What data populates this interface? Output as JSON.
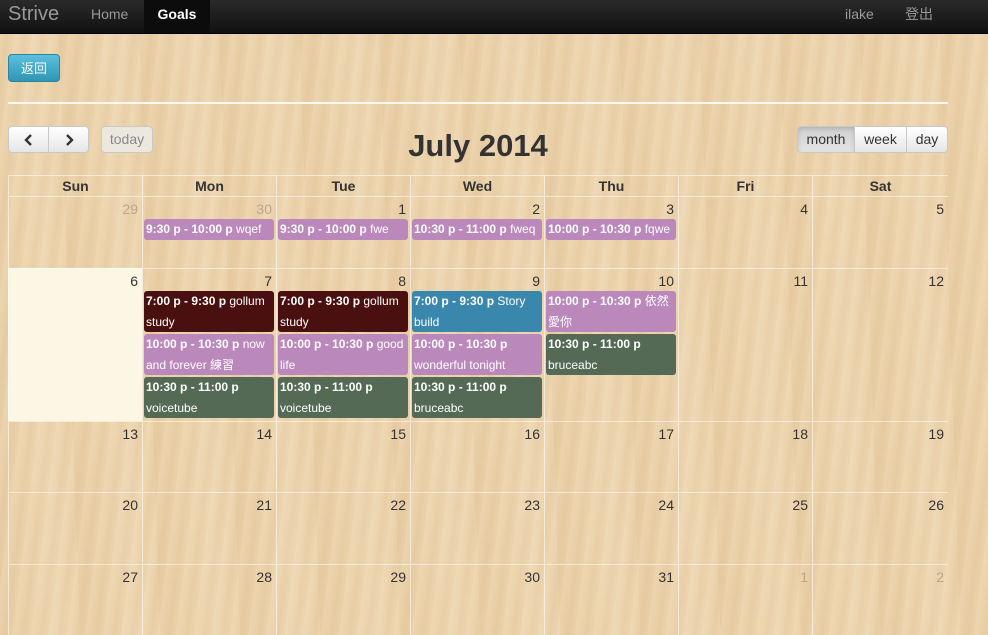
{
  "navbar": {
    "brand": "Strive",
    "home": "Home",
    "goals": "Goals",
    "user": "ilake",
    "logout": "登出"
  },
  "back_button": "返回",
  "toolbar": {
    "today": "today",
    "title": "July 2014",
    "views": [
      "month",
      "week",
      "day"
    ],
    "active_view": "month"
  },
  "calendar": {
    "weekdays": [
      "Sun",
      "Mon",
      "Tue",
      "Wed",
      "Thu",
      "Fri",
      "Sat"
    ],
    "today": "6",
    "weeks": [
      [
        {
          "d": "29",
          "other": true
        },
        {
          "d": "30",
          "other": true
        },
        {
          "d": "1"
        },
        {
          "d": "2"
        },
        {
          "d": "3"
        },
        {
          "d": "4"
        },
        {
          "d": "5"
        }
      ],
      [
        {
          "d": "6",
          "today": true
        },
        {
          "d": "7"
        },
        {
          "d": "8"
        },
        {
          "d": "9"
        },
        {
          "d": "10"
        },
        {
          "d": "11"
        },
        {
          "d": "12"
        }
      ],
      [
        {
          "d": "13"
        },
        {
          "d": "14"
        },
        {
          "d": "15"
        },
        {
          "d": "16"
        },
        {
          "d": "17"
        },
        {
          "d": "18"
        },
        {
          "d": "19"
        }
      ],
      [
        {
          "d": "20"
        },
        {
          "d": "21"
        },
        {
          "d": "22"
        },
        {
          "d": "23"
        },
        {
          "d": "24"
        },
        {
          "d": "25"
        },
        {
          "d": "26"
        }
      ],
      [
        {
          "d": "27"
        },
        {
          "d": "28"
        },
        {
          "d": "29"
        },
        {
          "d": "30"
        },
        {
          "d": "31"
        },
        {
          "d": "1",
          "other": true
        },
        {
          "d": "2",
          "other": true
        }
      ]
    ],
    "events": [
      {
        "week": 0,
        "day": 1,
        "slot": 0,
        "time": "9:30 p - 10:00 p",
        "title": "wqef",
        "color": "#bb88bb"
      },
      {
        "week": 0,
        "day": 2,
        "slot": 0,
        "time": "9:30 p - 10:00 p",
        "title": "fwe",
        "color": "#bb88bb"
      },
      {
        "week": 0,
        "day": 3,
        "slot": 0,
        "time": "10:30 p - 11:00 p",
        "title": "fweq",
        "color": "#bb88bb"
      },
      {
        "week": 0,
        "day": 4,
        "slot": 0,
        "time": "10:00 p - 10:30 p",
        "title": "fqwe",
        "color": "#bb88bb"
      },
      {
        "week": 1,
        "day": 1,
        "slot": 0,
        "time": "7:00 p - 9:30 p",
        "title": "gollum study",
        "color": "#4a1010"
      },
      {
        "week": 1,
        "day": 1,
        "slot": 1,
        "time": "10:00 p - 10:30 p",
        "title": "now and forever 練習",
        "color": "#bb88bb"
      },
      {
        "week": 1,
        "day": 1,
        "slot": 2,
        "time": "10:30 p - 11:00 p",
        "title": "voicetube",
        "color": "#546a55"
      },
      {
        "week": 1,
        "day": 2,
        "slot": 0,
        "time": "7:00 p - 9:30 p",
        "title": "gollum study",
        "color": "#4a1010"
      },
      {
        "week": 1,
        "day": 2,
        "slot": 1,
        "time": "10:00 p - 10:30 p",
        "title": "good life",
        "color": "#bb88bb"
      },
      {
        "week": 1,
        "day": 2,
        "slot": 2,
        "time": "10:30 p - 11:00 p",
        "title": "voicetube",
        "color": "#546a55"
      },
      {
        "week": 1,
        "day": 3,
        "slot": 0,
        "time": "7:00 p - 9:30 p",
        "title": "Story build",
        "color": "#3a87ad"
      },
      {
        "week": 1,
        "day": 3,
        "slot": 1,
        "time": "10:00 p - 10:30 p",
        "title": "wonderful tonight",
        "color": "#bb88bb"
      },
      {
        "week": 1,
        "day": 3,
        "slot": 2,
        "time": "10:30 p - 11:00 p",
        "title": "bruceabc",
        "color": "#546a55"
      },
      {
        "week": 1,
        "day": 4,
        "slot": 0,
        "time": "10:00 p - 10:30 p",
        "title": "依然愛你",
        "color": "#bb88bb"
      },
      {
        "week": 1,
        "day": 4,
        "slot": 1,
        "time": "10:30 p - 11:00 p",
        "title": "bruceabc",
        "color": "#546a55"
      }
    ]
  }
}
